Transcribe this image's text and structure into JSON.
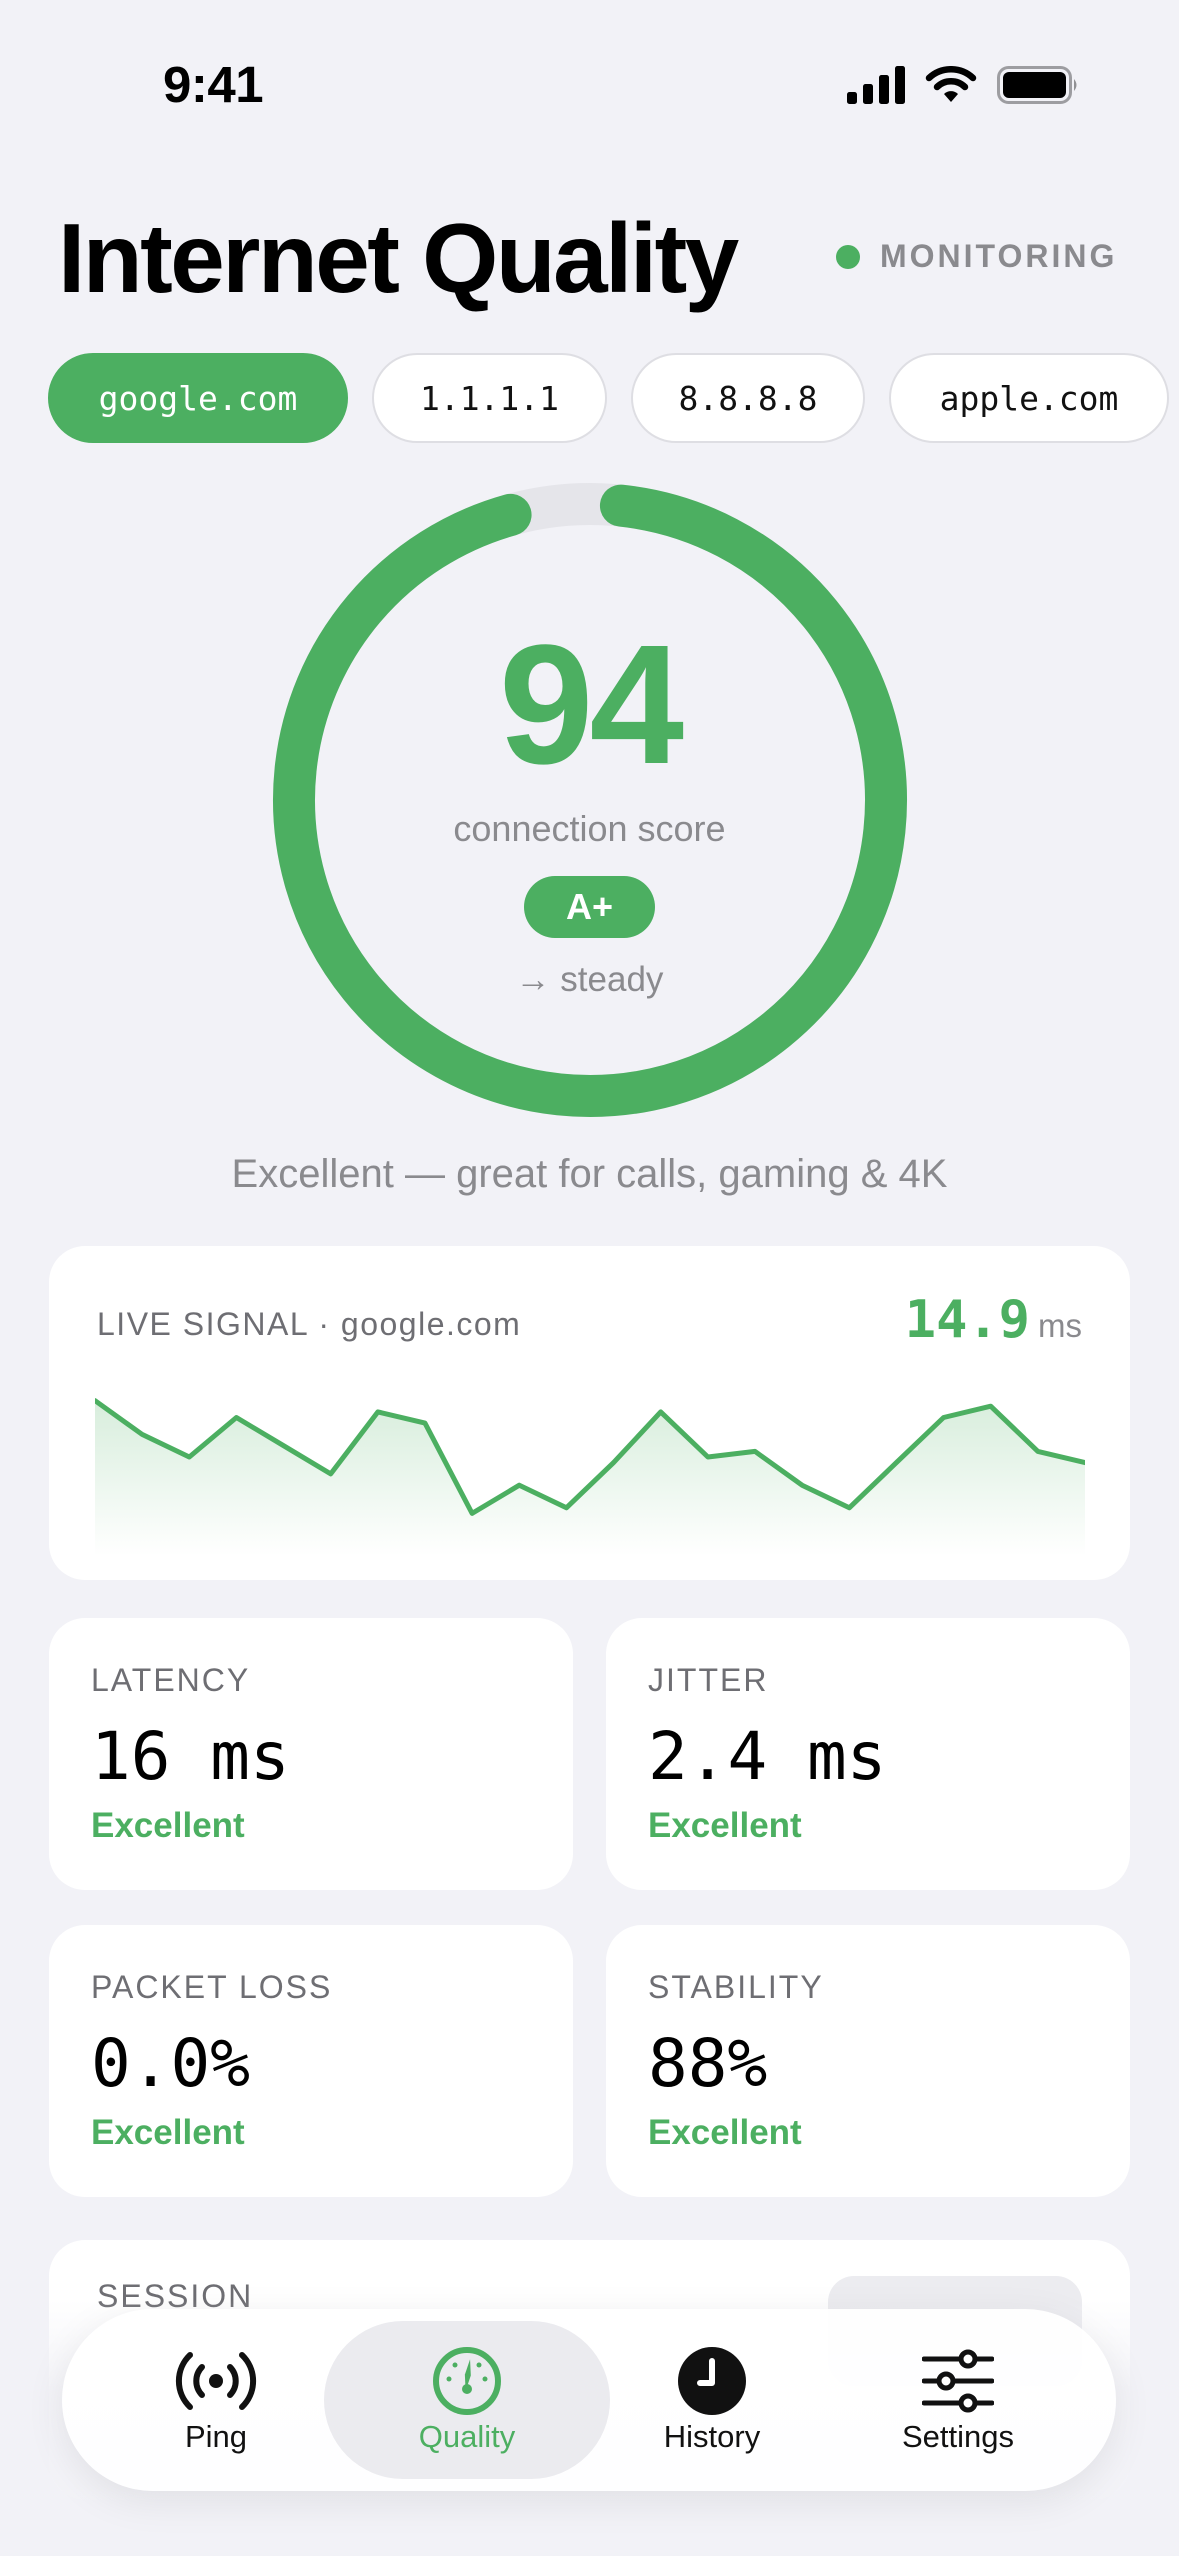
{
  "status_bar": {
    "time": "9:41"
  },
  "header": {
    "title": "Internet Quality",
    "status": "MONITORING",
    "status_color": "#4caf61"
  },
  "hosts": [
    {
      "label": "google.com",
      "selected": true
    },
    {
      "label": "1.1.1.1",
      "selected": false
    },
    {
      "label": "8.8.8.8",
      "selected": false
    },
    {
      "label": "apple.com",
      "selected": false
    }
  ],
  "score": {
    "value": "94",
    "caption": "connection score",
    "grade": "A+",
    "trend": "→ steady",
    "ring_fraction": 0.94,
    "color": "#4caf61"
  },
  "summary": "Excellent — great for calls, gaming & 4K",
  "live_signal": {
    "label": "LIVE SIGNAL · google.com",
    "value": "14.9",
    "unit": "ms",
    "samples": [
      18,
      15,
      13,
      16.5,
      14,
      11.5,
      17,
      16,
      8,
      10.5,
      8.5,
      12.5,
      17,
      13,
      13.5,
      10.5,
      8.5,
      12.5,
      16.5,
      17.5,
      13.5,
      12.5
    ]
  },
  "metrics": [
    {
      "label": "LATENCY",
      "value": "16 ms",
      "status": "Excellent"
    },
    {
      "label": "JITTER",
      "value": "2.4 ms",
      "status": "Excellent"
    },
    {
      "label": "PACKET LOSS",
      "value": "0.0%",
      "status": "Excellent"
    },
    {
      "label": "STABILITY",
      "value": "88%",
      "status": "Excellent"
    }
  ],
  "session": {
    "label": "SESSION"
  },
  "tab_bar": {
    "tabs": [
      {
        "label": "Ping",
        "icon": "antenna-icon",
        "active": false
      },
      {
        "label": "Quality",
        "icon": "gauge-icon",
        "active": true
      },
      {
        "label": "History",
        "icon": "clock-icon",
        "active": false
      },
      {
        "label": "Settings",
        "icon": "sliders-icon",
        "active": false
      }
    ]
  }
}
